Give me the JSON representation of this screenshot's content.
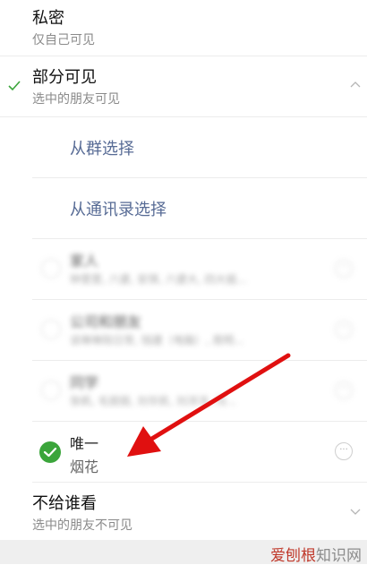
{
  "private": {
    "title": "私密",
    "subtitle": "仅自己可见"
  },
  "partial": {
    "title": "部分可见",
    "subtitle": "选中的朋友可见",
    "links": {
      "from_group": "从群选择",
      "from_contacts": "从通讯录选择"
    },
    "groups": [
      {
        "title": "家人",
        "subtitle": "钟雯雯, 六婆, 安琪, 六婆大, 四大姐..."
      },
      {
        "title": "公司和朋友",
        "subtitle": "谈琳琳陪日常, 钱建（电脑）, 周明..."
      },
      {
        "title": "同学",
        "subtitle": "张帆, 毛丽丽, 刘华民, 刘洋洋, 冯..."
      }
    ],
    "selected": {
      "title": "唯一",
      "subtitle": "烟花",
      "more": "···"
    }
  },
  "hide_from": {
    "title": "不给谁看",
    "subtitle": "选中的朋友不可见"
  },
  "watermark": {
    "part1": "爱刨根",
    "part2": "知识网"
  },
  "colors": {
    "link": "#576b95",
    "check": "#3ba53b",
    "arrow": "#e01010"
  }
}
